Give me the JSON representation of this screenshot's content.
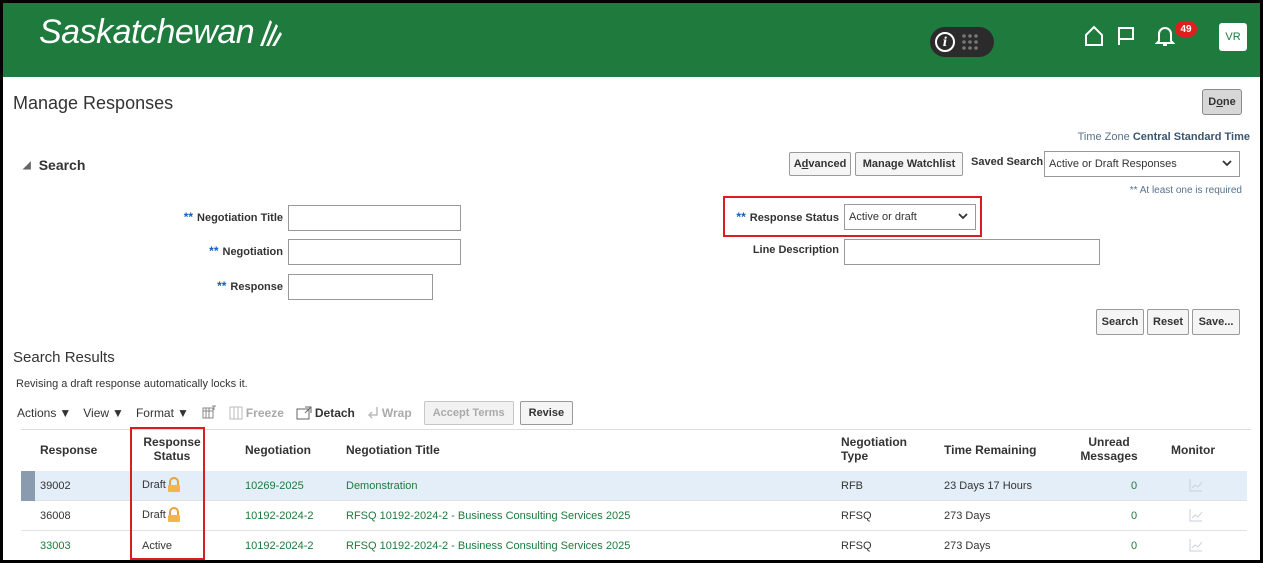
{
  "header": {
    "logo_text": "Saskatchewan",
    "notification_count": "49",
    "avatar_initials": "VR"
  },
  "page": {
    "title": "Manage Responses",
    "done_label": "Done",
    "time_zone_label": "Time Zone",
    "time_zone_value": "Central Standard Time"
  },
  "search": {
    "heading": "Search",
    "advanced_label": "Advanced",
    "manage_watchlist_label": "Manage Watchlist",
    "saved_search_label": "Saved Search",
    "saved_search_value": "Active or Draft Responses",
    "required_note": "** At least one is required",
    "fields": {
      "negotiation_title_label": "Negotiation Title",
      "negotiation_label": "Negotiation",
      "response_label": "Response",
      "response_status_label": "Response Status",
      "response_status_value": "Active or draft",
      "line_description_label": "Line Description"
    },
    "required_marker": "**",
    "buttons": {
      "search": "Search",
      "reset": "Reset",
      "save": "Save..."
    }
  },
  "results": {
    "heading": "Search Results",
    "hint": "Revising a draft response automatically locks it.",
    "toolbar": {
      "actions": "Actions",
      "view": "View",
      "format": "Format",
      "freeze": "Freeze",
      "detach": "Detach",
      "wrap": "Wrap",
      "accept_terms": "Accept Terms",
      "revise": "Revise"
    },
    "columns": {
      "response": "Response",
      "response_status_1": "Response",
      "response_status_2": "Status",
      "negotiation": "Negotiation",
      "negotiation_title": "Negotiation Title",
      "negotiation_type_1": "Negotiation",
      "negotiation_type_2": "Type",
      "time_remaining": "Time Remaining",
      "unread_1": "Unread",
      "unread_2": "Messages",
      "monitor": "Monitor"
    },
    "rows": [
      {
        "response": "39002",
        "status": "Draft",
        "negotiation": "10269-2025",
        "title": "Demonstration",
        "type": "RFB",
        "time_remaining": "23 Days 17 Hours",
        "unread": "0"
      },
      {
        "response": "36008",
        "status": "Draft",
        "negotiation": "10192-2024-2",
        "title": "RFSQ 10192-2024-2 - Business Consulting Services 2025",
        "type": "RFSQ",
        "time_remaining": "273 Days",
        "unread": "0"
      },
      {
        "response": "33003",
        "status": "Active",
        "negotiation": "10192-2024-2",
        "title": "RFSQ 10192-2024-2 - Business Consulting Services 2025",
        "type": "RFSQ",
        "time_remaining": "273 Days",
        "unread": "0"
      }
    ]
  },
  "colors": {
    "header_green": "#1f7a3d",
    "link_green": "#1e7a3c",
    "highlight_red": "#d81e1e",
    "selected_row": "#e3eef8"
  }
}
